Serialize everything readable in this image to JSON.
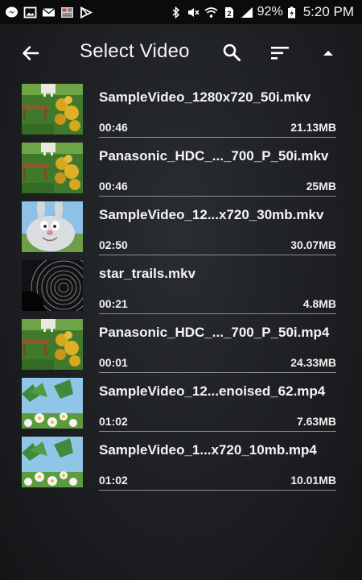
{
  "status_bar": {
    "left_icons": [
      "messenger-icon",
      "gallery-icon",
      "mail-icon",
      "news-icon",
      "play-store-icon"
    ],
    "right_icons": [
      "bluetooth-icon",
      "mute-icon",
      "wifi-icon",
      "sim-icon",
      "signal-icon",
      "battery-icon"
    ],
    "battery": "92%",
    "time": "5:20 PM"
  },
  "toolbar": {
    "title": "Select Video",
    "icons": [
      "back-arrow-icon",
      "search-icon",
      "sort-icon",
      "collapse-up-icon"
    ]
  },
  "videos": [
    {
      "name": "SampleVideo_1280x720_50i.mkv",
      "duration": "00:46",
      "size": "21.13MB",
      "thumb": "garden"
    },
    {
      "name": "Panasonic_HDC_..._700_P_50i.mkv",
      "duration": "00:46",
      "size": "25MB",
      "thumb": "garden"
    },
    {
      "name": "SampleVideo_12...x720_30mb.mkv",
      "duration": "02:50",
      "size": "30.07MB",
      "thumb": "bunny"
    },
    {
      "name": "star_trails.mkv",
      "duration": "00:21",
      "size": "4.8MB",
      "thumb": "stars"
    },
    {
      "name": "Panasonic_HDC_..._700_P_50i.mp4",
      "duration": "00:01",
      "size": "24.33MB",
      "thumb": "garden"
    },
    {
      "name": "SampleVideo_12...enoised_62.mp4",
      "duration": "01:02",
      "size": "7.63MB",
      "thumb": "daisies"
    },
    {
      "name": "SampleVideo_1...x720_10mb.mp4",
      "duration": "01:02",
      "size": "10.01MB",
      "thumb": "daisies"
    }
  ]
}
